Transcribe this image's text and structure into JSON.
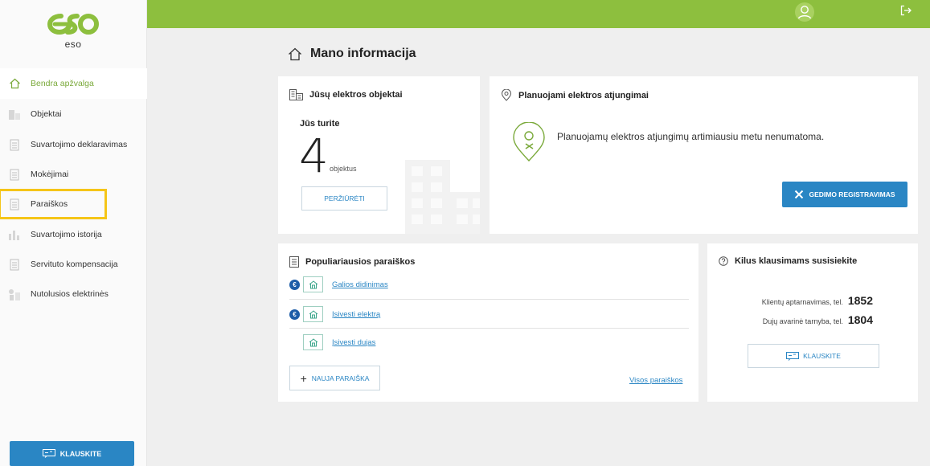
{
  "brand": {
    "logo_text": "eso",
    "accent": "#8dbf3e",
    "primary": "#2a86c4",
    "highlight": "#f5c518"
  },
  "sidebar": {
    "items": [
      {
        "label": "Bendra apžvalga",
        "icon": "home-icon"
      },
      {
        "label": "Objektai",
        "icon": "buildings-icon"
      },
      {
        "label": "Suvartojimo deklaravimas",
        "icon": "document-icon"
      },
      {
        "label": "Mokėjimai",
        "icon": "document-icon"
      },
      {
        "label": "Paraiškos",
        "icon": "document-icon"
      },
      {
        "label": "Suvartojimo istorija",
        "icon": "bar-chart-icon"
      },
      {
        "label": "Servituto kompensacija",
        "icon": "document-icon"
      },
      {
        "label": "Nutolusios elektrinės",
        "icon": "power-plant-icon"
      }
    ],
    "ask_button": "KLAUSKITE"
  },
  "page": {
    "title": "Mano informacija"
  },
  "objects_card": {
    "title": "Jūsų elektros objektai",
    "you_have": "Jūs turite",
    "count": "4",
    "unit": "objektus",
    "view_button": "PERŽIŪRĖTI"
  },
  "outages_card": {
    "title": "Planuojami elektros atjungimai",
    "message": "Planuojamų elektros atjungimų artimiausiu metu nenumatoma.",
    "register_button": "GEDIMO REGISTRAVIMAS"
  },
  "popular_card": {
    "title": "Populiariausios paraiškos",
    "items": [
      {
        "label": "Galios didinimas",
        "euro": "€"
      },
      {
        "label": "Įsivesti elektrą",
        "euro": "€"
      },
      {
        "label": "Įsivesti dujas",
        "euro": ""
      }
    ],
    "new_button": "NAUJA PARAIŠKA",
    "all_link": "Visos paraiškos"
  },
  "contact_card": {
    "title": "Kilus klausimams susisiekite",
    "lines": [
      {
        "label": "Klientų aptarnavimas, tel.",
        "number": "1852"
      },
      {
        "label": "Dujų avarinė tarnyba, tel.",
        "number": "1804"
      }
    ],
    "ask_button": "KLAUSKITE"
  }
}
